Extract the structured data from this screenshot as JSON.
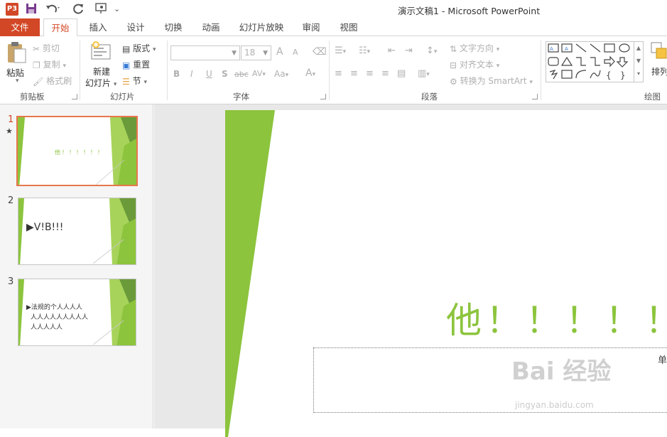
{
  "window": {
    "title": "演示文稿1 - Microsoft PowerPoint",
    "app_icon": "P3"
  },
  "quick_access": {
    "save": "💾",
    "undo": "↶",
    "redo": "↻",
    "slideshow": "▭",
    "customize": "⌄"
  },
  "tabs": [
    {
      "label": "文件"
    },
    {
      "label": "开始"
    },
    {
      "label": "插入"
    },
    {
      "label": "设计"
    },
    {
      "label": "切换"
    },
    {
      "label": "动画"
    },
    {
      "label": "幻灯片放映"
    },
    {
      "label": "审阅"
    },
    {
      "label": "视图"
    }
  ],
  "active_tab": "开始",
  "ribbon": {
    "clipboard": {
      "label": "剪贴板",
      "paste": "粘贴",
      "cut": "剪切",
      "copy": "复制",
      "format_painter": "格式刷"
    },
    "slides": {
      "label": "幻灯片",
      "new_slide_1": "新建",
      "new_slide_2": "幻灯片",
      "layout": "版式",
      "reset": "重置",
      "section": "节"
    },
    "font": {
      "label": "字体",
      "font_name": "",
      "font_size": "18",
      "bold": "B",
      "italic": "I",
      "underline": "U",
      "shadow": "S",
      "strike": "abc",
      "spacing": "AV",
      "case": "Aa",
      "color": "A",
      "grow": "A",
      "shrink": "A"
    },
    "paragraph": {
      "label": "段落",
      "text_direction": "文字方向",
      "align_text": "对齐文本",
      "smartart": "转换为 SmartArt"
    },
    "drawing": {
      "label": "绘图",
      "arrange": "排列"
    }
  },
  "slides": [
    {
      "num": "1",
      "has_animation_star": true,
      "thumb_text": "他！！！！！！",
      "selected": true
    },
    {
      "num": "2",
      "has_animation_star": false,
      "thumb_text": "▶V!B!!!",
      "selected": false
    },
    {
      "num": "3",
      "has_animation_star": false,
      "thumb_text_line1": "▶法规的个人人人人",
      "thumb_text_line2": "人人人人人人人人人",
      "thumb_text_line3": "人人人人人",
      "selected": false
    }
  ],
  "current_slide": {
    "title": "他！！！！！",
    "subtitle_placeholder": "单击"
  },
  "watermark": {
    "brand": "Bai 经验",
    "url": "jingyan.baidu.com"
  },
  "colors": {
    "accent": "#d24726",
    "green": "#8cc43d",
    "green_dark": "#6a9a3a"
  }
}
